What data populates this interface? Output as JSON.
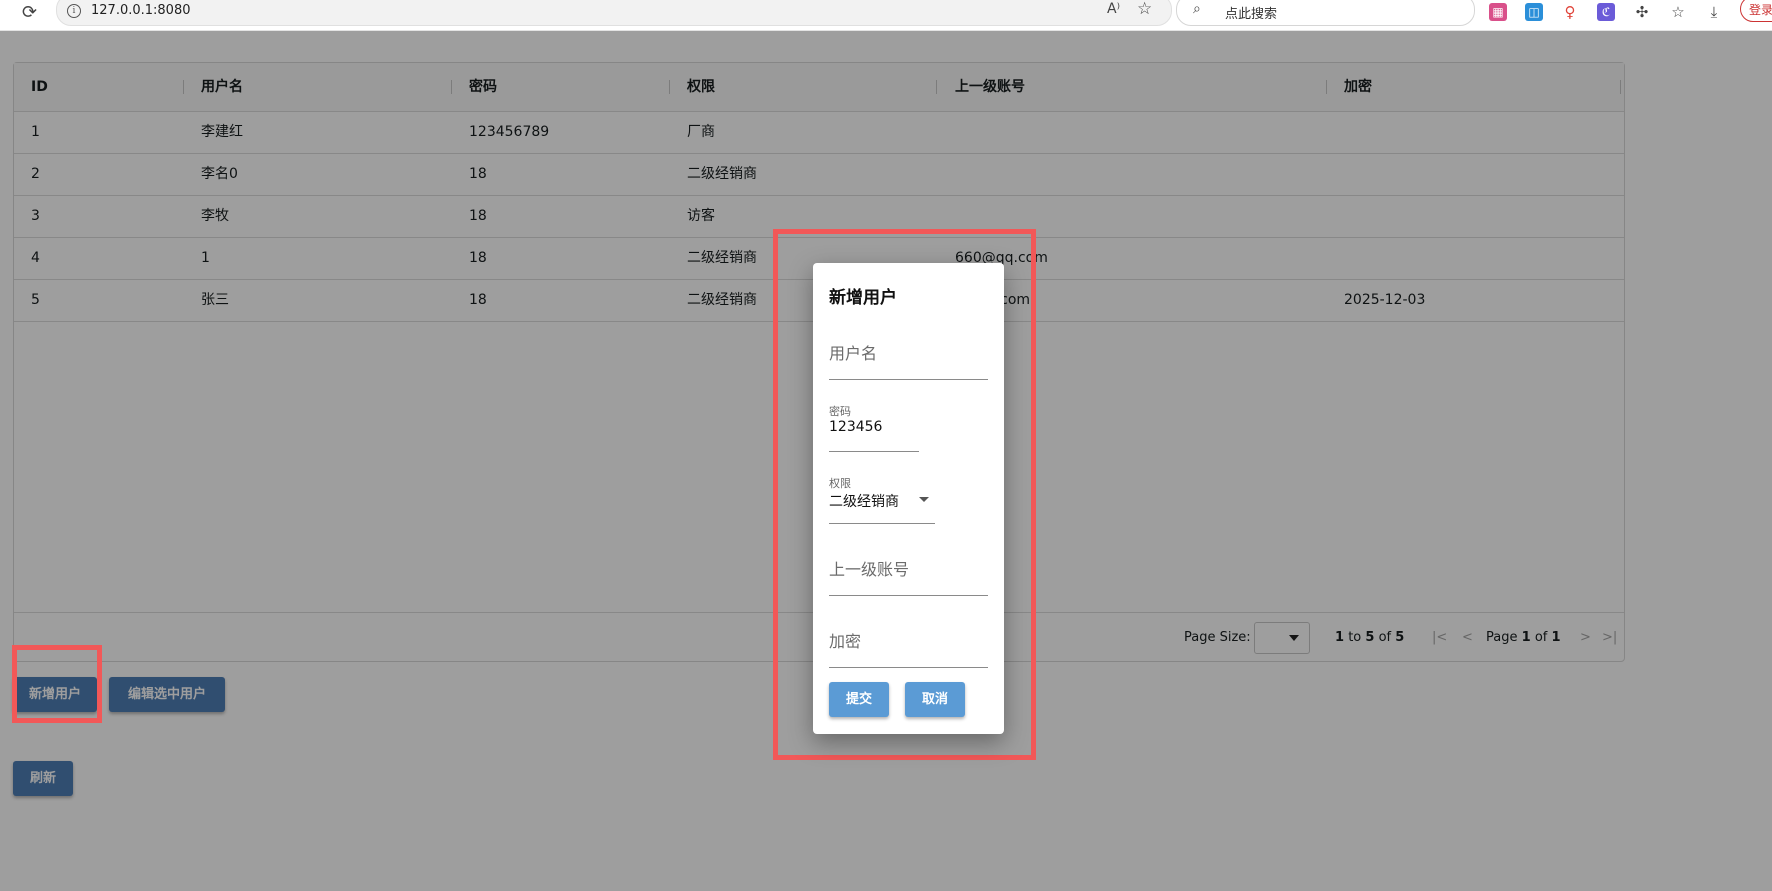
{
  "browser": {
    "url": "127.0.0.1:8080",
    "search_placeholder": "点此搜索",
    "login_label": "登录"
  },
  "grid": {
    "columns": [
      "ID",
      "用户名",
      "密码",
      "权限",
      "上一级账号",
      "加密"
    ],
    "rows": [
      [
        "1",
        "李建红",
        "123456789",
        "厂商",
        "",
        ""
      ],
      [
        "2",
        "李名0",
        "18",
        "二级经销商",
        "",
        ""
      ],
      [
        "3",
        "李牧",
        "18",
        "访客",
        "",
        ""
      ],
      [
        "4",
        "1",
        "18",
        "二级经销商",
        "660@qq.com",
        ""
      ],
      [
        "5",
        "张三",
        "18",
        "二级经销商",
        "1@qq.com",
        "2025-12-03"
      ]
    ],
    "footer": {
      "page_size_label": "Page Size:",
      "range_from": "1",
      "range_to_word": "to",
      "range_to": "5",
      "range_of_word": "of",
      "range_total": "5",
      "page_word": "Page",
      "page_current": "1",
      "page_of_word": "of",
      "page_total": "1"
    }
  },
  "actions": {
    "add_user": "新增用户",
    "edit_selected": "编辑选中用户",
    "refresh": "刷新"
  },
  "dialog": {
    "title": "新增用户",
    "username_placeholder": "用户名",
    "password_label": "密码",
    "password_value": "123456",
    "role_label": "权限",
    "role_value": "二级经销商",
    "parent_placeholder": "上一级账号",
    "encrypt_placeholder": "加密",
    "submit": "提交",
    "cancel": "取消"
  },
  "colors": {
    "highlight": "#f25858",
    "primary_button": "#5b9bd5"
  }
}
